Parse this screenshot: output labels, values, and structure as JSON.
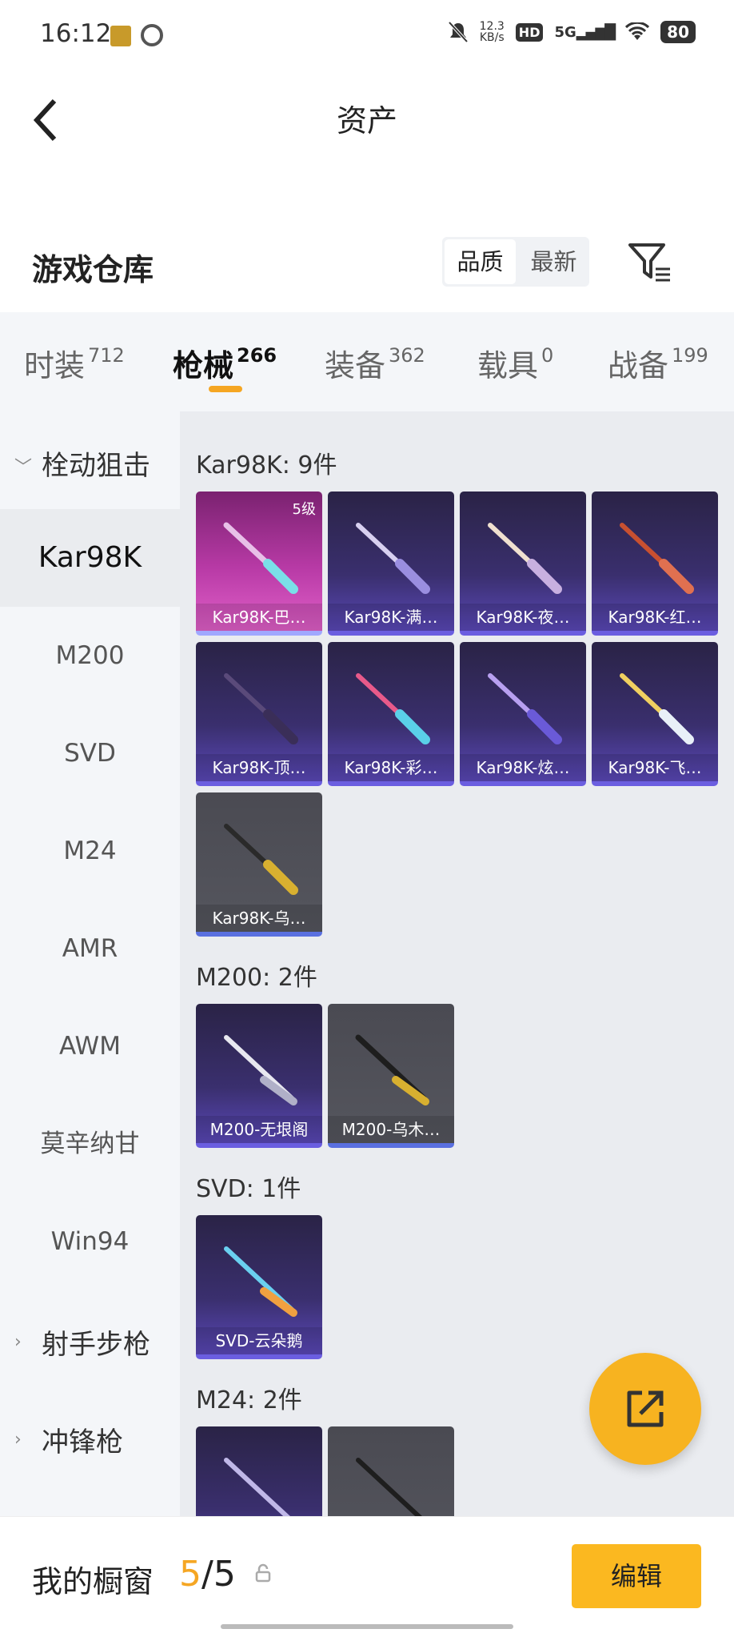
{
  "status_bar": {
    "time": "16:12",
    "net_speed": "12.3",
    "net_unit": "KB/s",
    "hd": "HD",
    "signal": "5G",
    "battery": "80"
  },
  "header": {
    "title": "资产"
  },
  "warehouse": {
    "title": "游戏仓库",
    "sort_options": [
      "品质",
      "最新"
    ],
    "sort_selected": "品质"
  },
  "tabs": [
    {
      "label": "时装",
      "count": "712"
    },
    {
      "label": "枪械",
      "count": "266",
      "active": true
    },
    {
      "label": "装备",
      "count": "362"
    },
    {
      "label": "载具",
      "count": "0"
    },
    {
      "label": "战备",
      "count": "199"
    }
  ],
  "sidebar": {
    "category_open": "栓动狙击",
    "items": [
      "Kar98K",
      "M200",
      "SVD",
      "M24",
      "AMR",
      "AWM",
      "莫辛纳甘",
      "Win94"
    ],
    "active_item": "Kar98K",
    "category_2": "射手步枪",
    "category_3": "冲锋枪"
  },
  "groups": [
    {
      "title": "Kar98K: 9件",
      "items": [
        {
          "label": "Kar98K-巴…",
          "level": "5级",
          "style": "pink"
        },
        {
          "label": "Kar98K-满…",
          "style": "purple"
        },
        {
          "label": "Kar98K-夜…",
          "style": "purple"
        },
        {
          "label": "Kar98K-红…",
          "style": "purple"
        },
        {
          "label": "Kar98K-顶…",
          "style": "purple"
        },
        {
          "label": "Kar98K-彩…",
          "style": "purple"
        },
        {
          "label": "Kar98K-炫…",
          "style": "purple"
        },
        {
          "label": "Kar98K-飞…",
          "style": "purple"
        },
        {
          "label": "Kar98K-乌…",
          "style": "gray"
        }
      ]
    },
    {
      "title": "M200: 2件",
      "items": [
        {
          "label": "M200-无垠阁",
          "style": "purple"
        },
        {
          "label": "M200-乌木…",
          "style": "gray"
        }
      ]
    },
    {
      "title": "SVD: 1件",
      "items": [
        {
          "label": "SVD-云朵鹅",
          "style": "purple"
        }
      ]
    },
    {
      "title": "M24: 2件",
      "items": [
        {
          "label": "",
          "style": "purple"
        },
        {
          "label": "",
          "style": "gray"
        }
      ]
    }
  ],
  "bottom": {
    "title": "我的橱窗",
    "current": "5",
    "total": "5",
    "edit_label": "编辑"
  }
}
